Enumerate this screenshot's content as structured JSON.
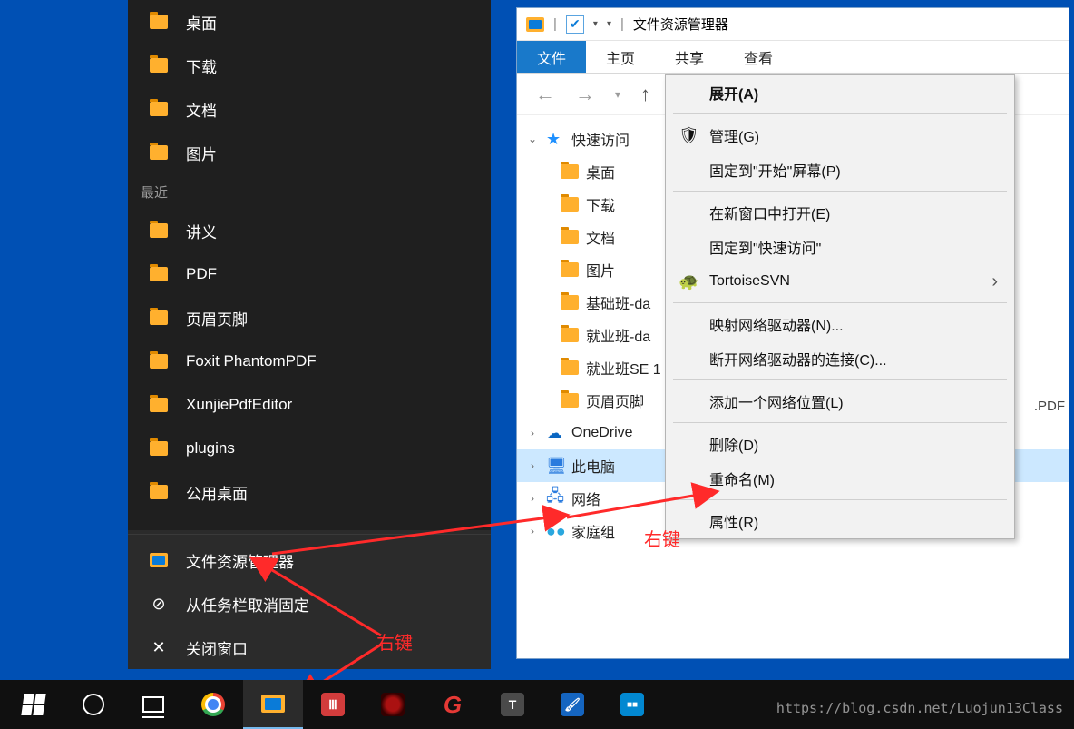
{
  "jump_list": {
    "main": [
      {
        "label": "桌面",
        "icon": "fold"
      },
      {
        "label": "下载",
        "icon": "fold"
      },
      {
        "label": "文档",
        "icon": "fold"
      },
      {
        "label": "图片",
        "icon": "fold"
      }
    ],
    "recent_header": "最近",
    "recent": [
      {
        "label": "讲义"
      },
      {
        "label": "PDF"
      },
      {
        "label": "页眉页脚"
      },
      {
        "label": "Foxit PhantomPDF"
      },
      {
        "label": "XunjiePdfEditor"
      },
      {
        "label": "plugins"
      },
      {
        "label": "公用桌面"
      }
    ],
    "bottom": [
      {
        "label": "文件资源管理器",
        "icon": "fe",
        "name": "file-explorer-item"
      },
      {
        "label": "从任务栏取消固定",
        "icon": "unpin",
        "name": "unpin-item"
      },
      {
        "label": "关闭窗口",
        "icon": "close",
        "name": "close-window-item"
      }
    ]
  },
  "explorer": {
    "title": "文件资源管理器",
    "tabs": {
      "file": "文件",
      "home": "主页",
      "share": "共享",
      "view": "查看"
    },
    "tree": {
      "quick": "快速访问",
      "quick_children": [
        "桌面",
        "下载",
        "文档",
        "图片",
        "基础班-da",
        "就业班-da",
        "就业班SE 1",
        "页眉页脚"
      ],
      "onedrive": "OneDrive",
      "thispc": "此电脑",
      "network": "网络",
      "homegroup": "家庭组"
    },
    "content_peek": ".PDF"
  },
  "context_menu": {
    "items": [
      {
        "label": "展开(A)",
        "bold": true
      },
      {
        "sep": true
      },
      {
        "label": "管理(G)",
        "icon": "🛡"
      },
      {
        "label": "固定到\"开始\"屏幕(P)"
      },
      {
        "sep": true
      },
      {
        "label": "在新窗口中打开(E)"
      },
      {
        "label": "固定到\"快速访问\""
      },
      {
        "label": "TortoiseSVN",
        "icon": "🐢",
        "submenu": true
      },
      {
        "sep": true
      },
      {
        "label": "映射网络驱动器(N)..."
      },
      {
        "label": "断开网络驱动器的连接(C)..."
      },
      {
        "sep": true
      },
      {
        "label": "添加一个网络位置(L)"
      },
      {
        "sep": true
      },
      {
        "label": "删除(D)"
      },
      {
        "label": "重命名(M)"
      },
      {
        "sep": true
      },
      {
        "label": "属性(R)"
      }
    ]
  },
  "annotations": {
    "a1": "右键",
    "a2": "右键"
  },
  "watermark": "https://blog.csdn.net/Luojun13Class"
}
